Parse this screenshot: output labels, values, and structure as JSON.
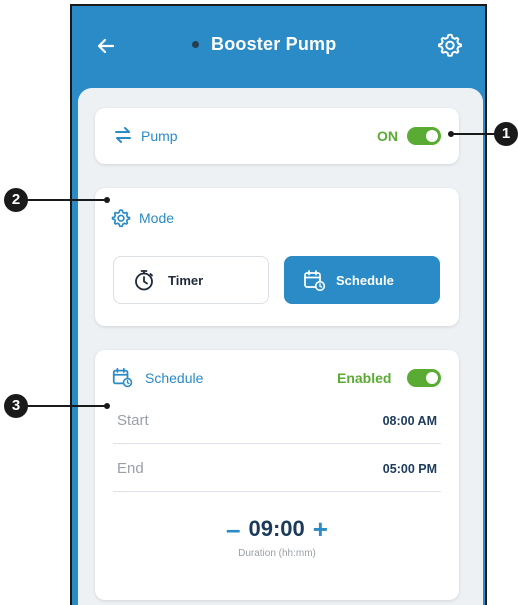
{
  "header": {
    "title": "Booster Pump"
  },
  "pump_card": {
    "label": "Pump",
    "status": "ON"
  },
  "mode_card": {
    "label": "Mode",
    "buttons": [
      {
        "label": "Timer"
      },
      {
        "label": "Schedule"
      }
    ]
  },
  "schedule_card": {
    "label": "Schedule",
    "status": "Enabled",
    "start": {
      "label": "Start",
      "value": "08:00 AM"
    },
    "end": {
      "label": "End",
      "value": "05:00 PM"
    },
    "duration": {
      "minus": "–",
      "value": "09:00",
      "plus": "+",
      "label": "Duration (hh:mm)"
    }
  },
  "callouts": [
    "1",
    "2",
    "3"
  ],
  "colors": {
    "primary": "#2a8bc6",
    "green": "#5aab33",
    "navy": "#1b3a5c",
    "background": "#eef1f4"
  },
  "icons": [
    "back-arrow-icon",
    "gear-icon",
    "sync-arrows-icon",
    "settings-cog-icon",
    "stopwatch-icon",
    "calendar-clock-icon"
  ]
}
